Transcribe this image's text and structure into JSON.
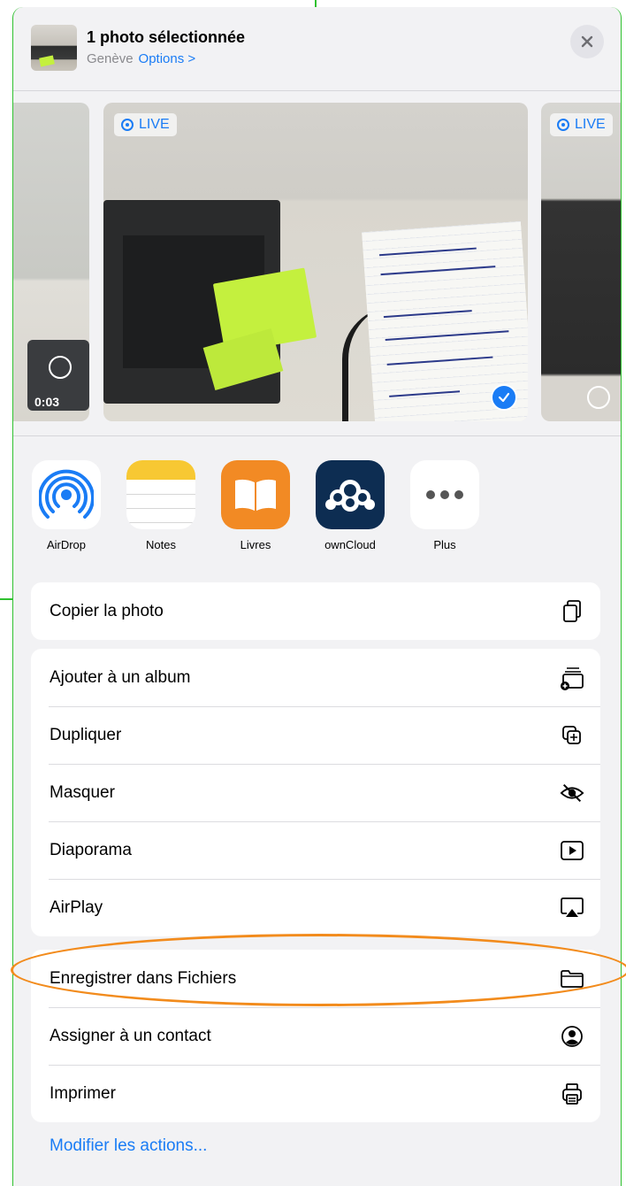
{
  "header": {
    "title": "1 photo sélectionnée",
    "location": "Genève",
    "options_label": "Options >"
  },
  "photos": {
    "live_label": "LIVE",
    "left_duration": "0:03"
  },
  "apps": [
    {
      "label": "AirDrop",
      "icon": "airdrop-icon"
    },
    {
      "label": "Notes",
      "icon": "notes-icon"
    },
    {
      "label": "Livres",
      "icon": "books-icon"
    },
    {
      "label": "ownCloud",
      "icon": "owncloud-icon"
    },
    {
      "label": "Plus",
      "icon": "more-icon"
    }
  ],
  "actions_group1": [
    {
      "label": "Copier la photo",
      "icon": "copy-icon"
    }
  ],
  "actions_group2": [
    {
      "label": "Ajouter à un album",
      "icon": "add-album-icon"
    },
    {
      "label": "Dupliquer",
      "icon": "duplicate-icon"
    },
    {
      "label": "Masquer",
      "icon": "hide-icon"
    },
    {
      "label": "Diaporama",
      "icon": "slideshow-icon"
    },
    {
      "label": "AirPlay",
      "icon": "airplay-icon"
    }
  ],
  "actions_group3": [
    {
      "label": "Enregistrer dans Fichiers",
      "icon": "folder-icon"
    },
    {
      "label": "Assigner à un contact",
      "icon": "contact-icon"
    },
    {
      "label": "Imprimer",
      "icon": "printer-icon"
    }
  ],
  "footer": {
    "modify_actions": "Modifier les actions..."
  },
  "colors": {
    "accent": "#1a7cf5",
    "annotation_orange": "#f28b1c",
    "annotation_green": "#2fc12f"
  }
}
